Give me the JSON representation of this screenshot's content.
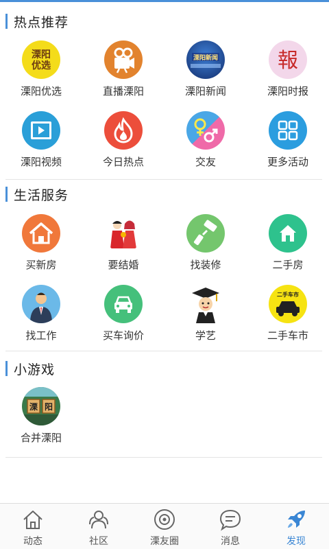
{
  "sections": [
    {
      "title": "热点推荐",
      "items": [
        {
          "label": "溧阳优选",
          "icon": "liyang-youxuan-icon",
          "icon_text": "溧阳优选"
        },
        {
          "label": "直播溧阳",
          "icon": "video-camera-icon"
        },
        {
          "label": "溧阳新闻",
          "icon": "liyang-news-icon",
          "icon_text": "溧阳新闻"
        },
        {
          "label": "溧阳时报",
          "icon": "newspaper-calligraphy-icon",
          "icon_text": "報"
        },
        {
          "label": "溧阳视频",
          "icon": "video-film-icon"
        },
        {
          "label": "今日热点",
          "icon": "flame-icon"
        },
        {
          "label": "交友",
          "icon": "gender-symbols-icon"
        },
        {
          "label": "更多活动",
          "icon": "grid-apps-icon"
        }
      ]
    },
    {
      "title": "生活服务",
      "items": [
        {
          "label": "买新房",
          "icon": "house-icon"
        },
        {
          "label": "要结婚",
          "icon": "wedding-couple-icon"
        },
        {
          "label": "找装修",
          "icon": "paint-roller-icon"
        },
        {
          "label": "二手房",
          "icon": "small-house-icon"
        },
        {
          "label": "找工作",
          "icon": "businessman-icon"
        },
        {
          "label": "买车询价",
          "icon": "car-front-icon"
        },
        {
          "label": "学艺",
          "icon": "graduate-icon"
        },
        {
          "label": "二手车市",
          "icon": "used-car-icon",
          "icon_text": "二手车市"
        }
      ]
    },
    {
      "title": "小游戏",
      "items": [
        {
          "label": "合并溧阳",
          "icon": "merge-game-icon",
          "icon_text": [
            "溧",
            "阳"
          ]
        }
      ]
    }
  ],
  "tabbar": [
    {
      "label": "动态",
      "icon": "home-icon",
      "active": false
    },
    {
      "label": "社区",
      "icon": "community-icon",
      "active": false
    },
    {
      "label": "溧友圈",
      "icon": "circle-lens-icon",
      "active": false
    },
    {
      "label": "消息",
      "icon": "message-bubble-icon",
      "active": false
    },
    {
      "label": "发现",
      "icon": "rocket-icon",
      "active": true
    }
  ],
  "colors": {
    "accent": "#4a90d9",
    "active_tab": "#3a86d4"
  }
}
